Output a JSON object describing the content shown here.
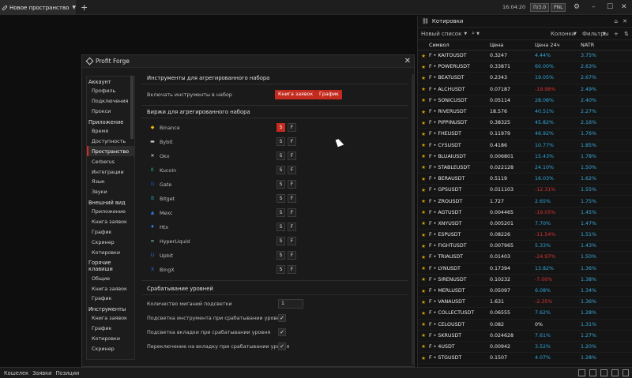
{
  "topbar": {
    "workspace": "Новое пространство",
    "time": "16:04:20",
    "badge1": "П/3.0",
    "badge2": "PNL"
  },
  "quotes": {
    "title": "Котировки",
    "new_list": "Новый список",
    "columns": "Колонки",
    "filters": "Фильтры",
    "headers": {
      "symbol": "Символ",
      "price": "Цена",
      "change": "Цена 24ч",
      "natr": "NATR"
    },
    "rows": [
      {
        "sym": "F • KAITOUSDT",
        "price": "0.3247",
        "chg": "4.44%",
        "dir": "pos",
        "natr": "3.75%"
      },
      {
        "sym": "F • POWERUSDT",
        "price": "0.33871",
        "chg": "60.00%",
        "dir": "pos",
        "natr": "2.63%"
      },
      {
        "sym": "F • BEATUSDT",
        "price": "0.2343",
        "chg": "19.05%",
        "dir": "pos",
        "natr": "2.67%"
      },
      {
        "sym": "F • ALCHUSDT",
        "price": "0.07187",
        "chg": "-19.98%",
        "dir": "neg",
        "natr": "2.49%"
      },
      {
        "sym": "F • SONICUSDT",
        "price": "0.05114",
        "chg": "28.08%",
        "dir": "pos",
        "natr": "2.40%"
      },
      {
        "sym": "F • RIVERUSDT",
        "price": "18.576",
        "chg": "40.51%",
        "dir": "pos",
        "natr": "2.27%"
      },
      {
        "sym": "F • PIPPINUSDT",
        "price": "0.38325",
        "chg": "45.82%",
        "dir": "pos",
        "natr": "2.16%"
      },
      {
        "sym": "F • FHEUSDT",
        "price": "0.11979",
        "chg": "46.92%",
        "dir": "pos",
        "natr": "1.76%"
      },
      {
        "sym": "F • CYSUSDT",
        "price": "0.4186",
        "chg": "10.77%",
        "dir": "pos",
        "natr": "1.85%"
      },
      {
        "sym": "F • BLUAIUSDT",
        "price": "0.006801",
        "chg": "15.43%",
        "dir": "pos",
        "natr": "1.78%"
      },
      {
        "sym": "F • STABLEUSDT",
        "price": "0.022128",
        "chg": "24.10%",
        "dir": "pos",
        "natr": "1.50%"
      },
      {
        "sym": "F • BERAUSDT",
        "price": "0.5119",
        "chg": "16.03%",
        "dir": "pos",
        "natr": "1.62%"
      },
      {
        "sym": "F • GPSUSDT",
        "price": "0.011103",
        "chg": "-12.31%",
        "dir": "neg",
        "natr": "1.55%"
      },
      {
        "sym": "F • ZROUSDT",
        "price": "1.727",
        "chg": "2.65%",
        "dir": "pos",
        "natr": "1.75%"
      },
      {
        "sym": "F • AGTUSDT",
        "price": "0.004465",
        "chg": "-19.05%",
        "dir": "neg",
        "natr": "1.45%"
      },
      {
        "sym": "F • XNYUSDT",
        "price": "0.005201",
        "chg": "7.70%",
        "dir": "pos",
        "natr": "1.47%"
      },
      {
        "sym": "F • ESPUSDT",
        "price": "0.08226",
        "chg": "-11.54%",
        "dir": "neg",
        "natr": "1.51%"
      },
      {
        "sym": "F • FIGHTUSDT",
        "price": "0.007965",
        "chg": "5.33%",
        "dir": "pos",
        "natr": "1.43%"
      },
      {
        "sym": "F • TRIAUSDT",
        "price": "0.01403",
        "chg": "-24.97%",
        "dir": "neg",
        "natr": "1.50%"
      },
      {
        "sym": "F • LYNUSDT",
        "price": "0.17394",
        "chg": "13.82%",
        "dir": "pos",
        "natr": "1.36%"
      },
      {
        "sym": "F • SIRENUSDT",
        "price": "0.10232",
        "chg": "-7.00%",
        "dir": "neg",
        "natr": "1.38%"
      },
      {
        "sym": "F • MERLUSDT",
        "price": "0.05097",
        "chg": "6.08%",
        "dir": "pos",
        "natr": "1.34%"
      },
      {
        "sym": "F • VANAUSDT",
        "price": "1.631",
        "chg": "-2.35%",
        "dir": "neg",
        "natr": "1.36%"
      },
      {
        "sym": "F • COLLECTUSDT",
        "price": "0.06555",
        "chg": "7.62%",
        "dir": "pos",
        "natr": "1.28%"
      },
      {
        "sym": "F • CELOUSDT",
        "price": "0.082",
        "chg": "0%",
        "dir": "zero",
        "natr": "1.31%"
      },
      {
        "sym": "F • SKRUSDT",
        "price": "0.024628",
        "chg": "7.61%",
        "dir": "pos",
        "natr": "1.27%"
      },
      {
        "sym": "F • 4USDT",
        "price": "0.00942",
        "chg": "3.52%",
        "dir": "pos",
        "natr": "1.20%"
      },
      {
        "sym": "F • STGUSDT",
        "price": "0.1507",
        "chg": "4.07%",
        "dir": "pos",
        "natr": "1.28%"
      }
    ]
  },
  "dialog": {
    "title": "Profit Forge",
    "sidebar": [
      {
        "group": "Аккаунт",
        "items": [
          "Профиль",
          "Подключения",
          "Прокси"
        ]
      },
      {
        "group": "Приложение",
        "items": [
          "Время",
          "Доступность",
          "Пространство",
          "Cerberus",
          "Интеграции",
          "Язык",
          "Звуки"
        ]
      },
      {
        "group": "Внешний вид",
        "items": [
          "Приложение",
          "Книга заявок",
          "График",
          "Скринер",
          "Котировки"
        ]
      },
      {
        "group": "Горячие клавиши",
        "items": [
          "Общие",
          "Книга заявок",
          "График"
        ]
      },
      {
        "group": "Инструменты",
        "items": [
          "Книга заявок",
          "График",
          "Котировки",
          "Скринер"
        ]
      }
    ],
    "active_item": "Пространство",
    "section1": "Инструменты для агрегированного набора",
    "include_label": "Включать инструменты в набор",
    "btn_orderbook": "Книга заявок",
    "btn_chart": "График",
    "section2": "Биржи для агрегированного набора",
    "exchanges": [
      {
        "name": "Binance",
        "icon": "binance-icon",
        "s_on": true
      },
      {
        "name": "Bybit",
        "icon": "bybit-icon",
        "s_on": false
      },
      {
        "name": "Okx",
        "icon": "okx-icon",
        "s_on": false
      },
      {
        "name": "Kucoin",
        "icon": "kucoin-icon",
        "s_on": false
      },
      {
        "name": "Gate",
        "icon": "gate-icon",
        "s_on": false
      },
      {
        "name": "Bitget",
        "icon": "bitget-icon",
        "s_on": false
      },
      {
        "name": "Mexc",
        "icon": "mexc-icon",
        "s_on": false
      },
      {
        "name": "Htx",
        "icon": "htx-icon",
        "s_on": false
      },
      {
        "name": "HyperLiquid",
        "icon": "hyperliquid-icon",
        "s_on": false
      },
      {
        "name": "Upbit",
        "icon": "upbit-icon",
        "s_on": false
      },
      {
        "name": "BingX",
        "icon": "bingx-icon",
        "s_on": false
      }
    ],
    "s_label": "S",
    "f_label": "F",
    "section3": "Срабатывание уровней",
    "blink_label": "Количество миганий подсветки",
    "blink_value": "1",
    "checks": [
      "Подсветка инструмента при срабатывании уровня",
      "Подсветка вкладки при срабатывании уровня",
      "Переключение на вкладку при срабатывании уровня"
    ]
  },
  "bottombar": {
    "tabs": [
      "Кошелек",
      "Заявки",
      "Позиции"
    ]
  }
}
